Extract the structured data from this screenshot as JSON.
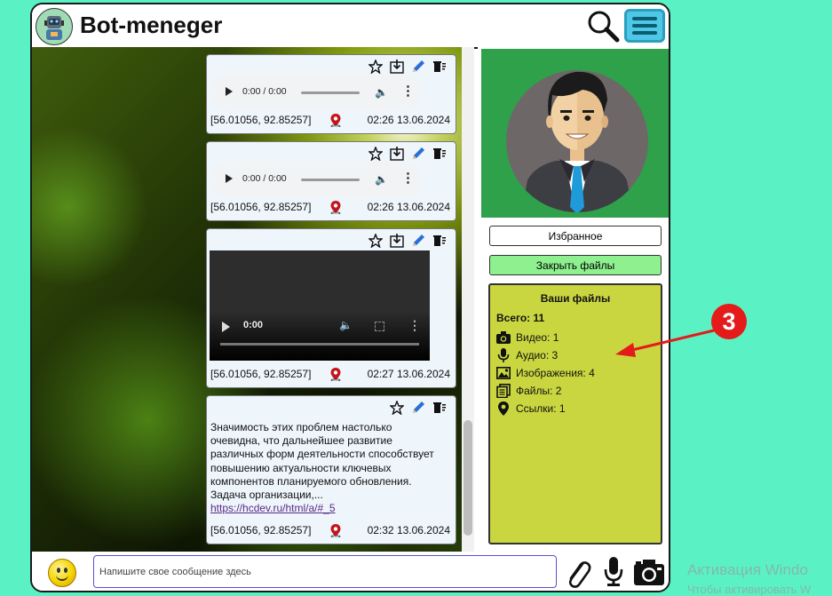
{
  "header": {
    "title": "Bot-meneger",
    "logo_icon": "robot-avatar-icon",
    "search_icon": "search-icon",
    "menu_icon": "hamburger-menu-icon"
  },
  "messages": [
    {
      "type": "audio",
      "player_time": "0:00 / 0:00",
      "coords": "[56.01056, 92.85257]",
      "timestamp": "02:26 13.06.2024"
    },
    {
      "type": "audio",
      "player_time": "0:00 / 0:00",
      "coords": "[56.01056, 92.85257]",
      "timestamp": "02:26 13.06.2024"
    },
    {
      "type": "video",
      "player_time": "0:00",
      "coords": "[56.01056, 92.85257]",
      "timestamp": "02:27 13.06.2024"
    },
    {
      "type": "text",
      "text_lines": [
        "Значимость этих проблем настолько",
        "очевидна, что дальнейшее развитие",
        "различных форм деятельности способствует",
        "повышению актуальности ключевых",
        "компонентов планируемого обновления.",
        "Задача организации,..."
      ],
      "link": "https://hcdev.ru/html/a/#_5",
      "coords": "[56.01056, 92.85257]",
      "timestamp": "02:32 13.06.2024"
    }
  ],
  "sidebar": {
    "favorites_label": "Избранное",
    "close_files_label": "Закрыть файлы",
    "files": {
      "title": "Ваши файлы",
      "total": "Всего: 11",
      "rows": [
        {
          "icon": "camera-icon",
          "label": "Видео: 1"
        },
        {
          "icon": "microphone-icon",
          "label": "Аудио: 3"
        },
        {
          "icon": "image-icon",
          "label": "Изображения: 4"
        },
        {
          "icon": "documents-icon",
          "label": "Файлы: 2"
        },
        {
          "icon": "location-pin-icon",
          "label": "Ссылки: 1"
        }
      ]
    }
  },
  "footer": {
    "input_placeholder": "Напишите свое сообщение здесь",
    "emoji_icon": "smiley-icon",
    "attach_icon": "paperclip-icon",
    "mic_icon": "microphone-icon",
    "camera_icon": "camera-icon"
  },
  "annotation": {
    "number": "3",
    "color": "#e51a1a"
  },
  "watermark": {
    "line1": "Активация Windo",
    "line2": "Чтобы активировать W"
  },
  "colors": {
    "background": "#5af2c4",
    "menu": "#4fc8e5",
    "avatar_bg": "#2ea14a",
    "close_btn": "#8ef08e",
    "files_panel": "#c9d640",
    "link": "#5b2a86"
  }
}
